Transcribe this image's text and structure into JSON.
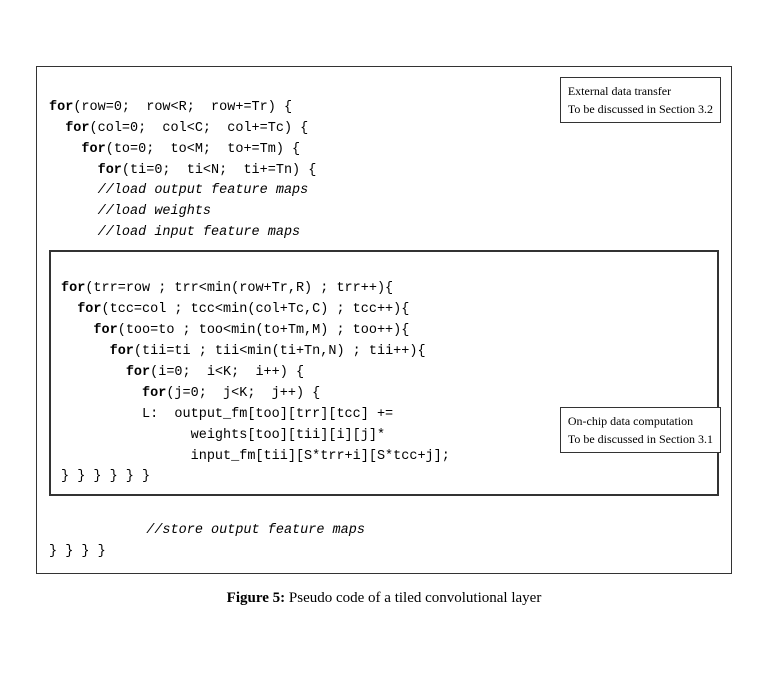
{
  "figure": {
    "caption": "Figure 5:  Pseudo code of a tiled convolutional layer",
    "annotation_top": {
      "line1": "External data transfer",
      "line2": "To be discussed in Section 3.2"
    },
    "annotation_bottom": {
      "line1": "On-chip data computation",
      "line2": "To be discussed in Section 3.1"
    },
    "outer_code": {
      "lines": [
        "for(row=0;  row<R;  row+=Tr) {",
        "  for(col=0;  col<C;  col+=Tc) {",
        "    for(to=0;  to<M;  to+=Tm) {",
        "      for(ti=0;  ti<N;  ti+=Tn) {",
        "      //load output feature maps",
        "      //load weights",
        "      //load input feature maps"
      ]
    },
    "inner_code": {
      "lines": [
        "for(trr=row ; trr<min(row+Tr,R) ; trr++){",
        "  for(tcc=col ; tcc<min(col+Tc,C) ; tcc++){",
        "    for(too=to ; too<min(to+Tm,M) ; too++){",
        "      for(tii=ti ; tii<min(ti+Tn,N) ; tii++){",
        "        for(i=0;  i<K;  i++) {",
        "          for(j=0;  j<K;  j++) {",
        "          L:  output_fm[too][trr][tcc] +=",
        "                weights[too][tii][i][j]*",
        "                input_fm[tii][S*trr+i][S*tcc+j];",
        "} } } } } }"
      ]
    },
    "closing_lines": {
      "store": "      //store output feature maps",
      "braces": "} } } }"
    }
  }
}
